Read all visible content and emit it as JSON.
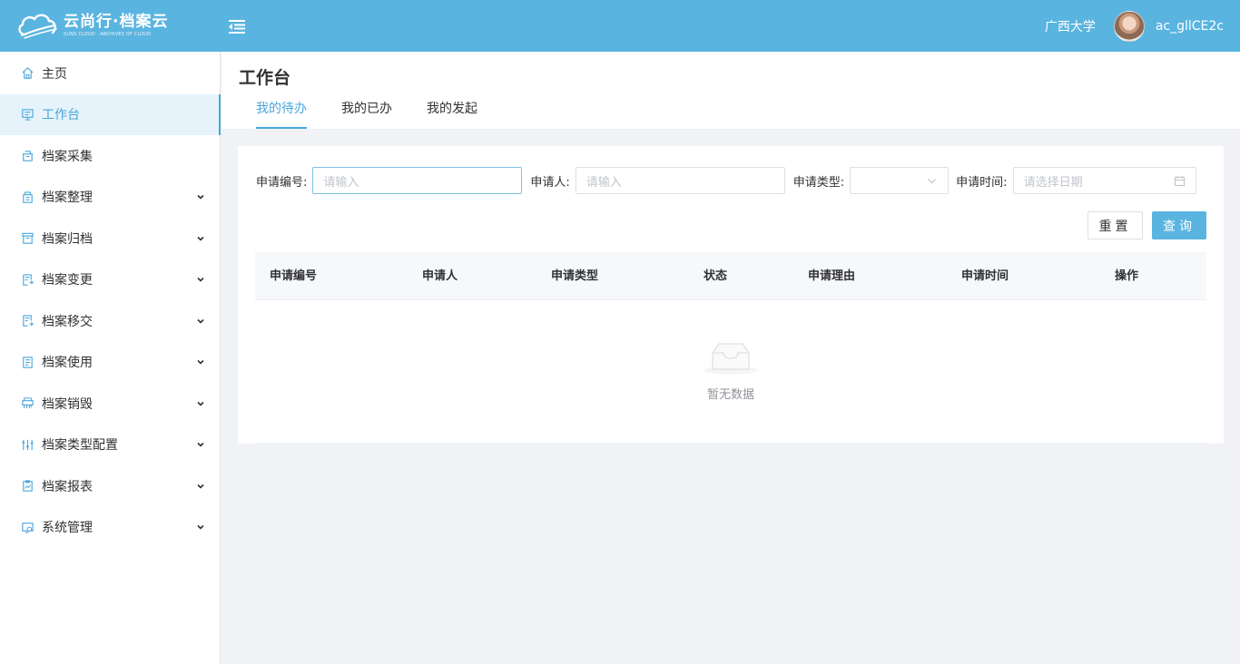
{
  "header": {
    "logo_title": "云尚行·档案云",
    "logo_subtitle": "SUNS CLOUD · ARCHIVES OF CLOUD",
    "org": "广西大学",
    "username": "ac_gllCE2c"
  },
  "sidebar": {
    "items": [
      {
        "label": "主页",
        "icon": "home-icon",
        "expandable": false
      },
      {
        "label": "工作台",
        "icon": "workbench-icon",
        "expandable": false,
        "active": true
      },
      {
        "label": "档案采集",
        "icon": "collect-icon",
        "expandable": false
      },
      {
        "label": "档案整理",
        "icon": "organize-icon",
        "expandable": true
      },
      {
        "label": "档案归档",
        "icon": "archive-box-icon",
        "expandable": true
      },
      {
        "label": "档案变更",
        "icon": "change-icon",
        "expandable": true
      },
      {
        "label": "档案移交",
        "icon": "transfer-icon",
        "expandable": true
      },
      {
        "label": "档案使用",
        "icon": "usage-icon",
        "expandable": true
      },
      {
        "label": "档案销毁",
        "icon": "destroy-icon",
        "expandable": true
      },
      {
        "label": "档案类型配置",
        "icon": "sliders-icon",
        "expandable": true
      },
      {
        "label": "档案报表",
        "icon": "report-icon",
        "expandable": true
      },
      {
        "label": "系统管理",
        "icon": "system-icon",
        "expandable": true
      }
    ]
  },
  "page": {
    "title": "工作台",
    "tabs": [
      {
        "label": "我的待办",
        "active": true
      },
      {
        "label": "我的已办",
        "active": false
      },
      {
        "label": "我的发起",
        "active": false
      }
    ]
  },
  "filters": {
    "app_no_label": "申请编号:",
    "app_no_placeholder": "请输入",
    "applicant_label": "申请人:",
    "applicant_placeholder": "请输入",
    "type_label": "申请类型:",
    "type_value": "",
    "time_label": "申请时间:",
    "time_placeholder": "请选择日期",
    "reset_label": "重置",
    "query_label": "查询"
  },
  "table": {
    "columns": [
      "申请编号",
      "申请人",
      "申请类型",
      "状态",
      "申请理由",
      "申请时间",
      "操作"
    ],
    "rows": [],
    "empty_text": "暂无数据"
  },
  "colors": {
    "brand": "#5ab4e0",
    "accent": "#4aa6dc"
  }
}
